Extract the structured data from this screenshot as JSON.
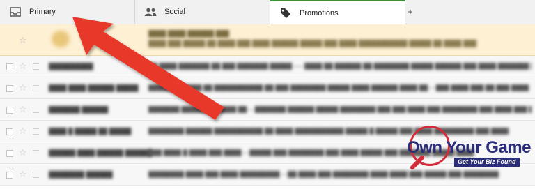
{
  "tabs": [
    {
      "label": "Primary",
      "icon": "inbox-icon"
    },
    {
      "label": "Social",
      "icon": "people-icon"
    },
    {
      "label": "Promotions",
      "icon": "tag-icon",
      "active": true
    }
  ],
  "add_tab": "+",
  "colors": {
    "active_tab_border": "#3e8e3e",
    "arrow": "#e8392a",
    "promo_bg": "#fdf0d3",
    "logo_blue": "#2a2d7a",
    "logo_red": "#d42b3a"
  },
  "logo": {
    "text": "Own Your Game",
    "tagline": "Get Your Biz Found"
  }
}
